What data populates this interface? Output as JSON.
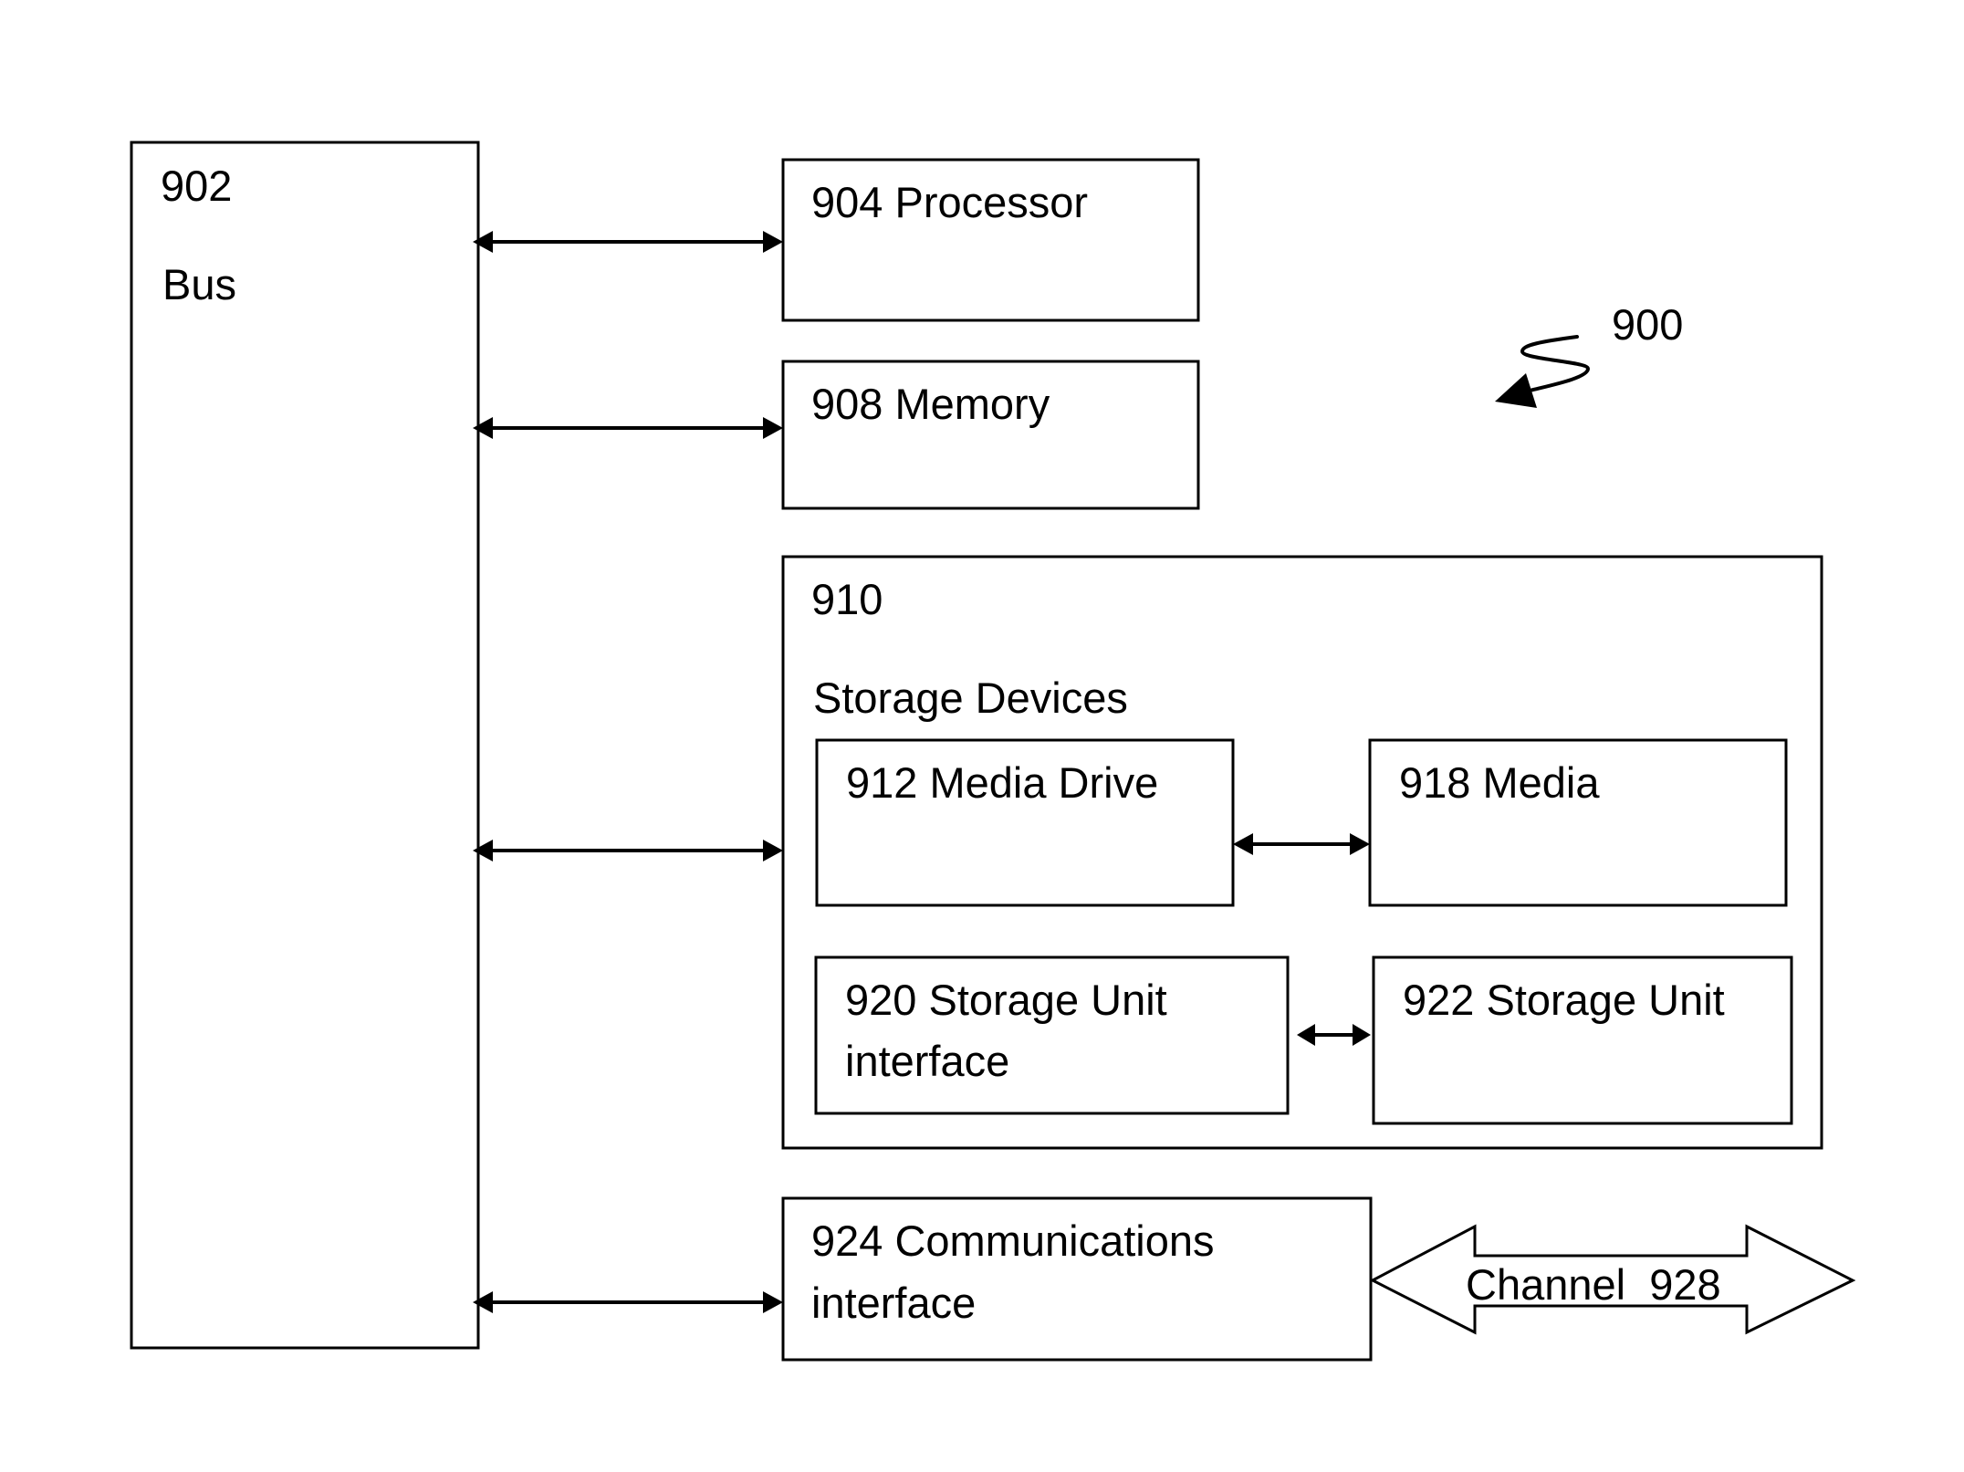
{
  "figure": {
    "reference": "900",
    "bus": {
      "number": "902",
      "label": "Bus"
    },
    "processor": {
      "label": "904 Processor"
    },
    "memory": {
      "label": "908 Memory"
    },
    "storage": {
      "number": "910",
      "label": "Storage Devices",
      "media_drive": {
        "label": "912 Media Drive"
      },
      "media": {
        "label": "918 Media"
      },
      "storage_unit_interface": {
        "line1": "920 Storage Unit",
        "line2": "interface"
      },
      "storage_unit": {
        "label": "922 Storage Unit"
      }
    },
    "communications": {
      "line1": "924 Communications",
      "line2": "interface"
    },
    "channel": {
      "label": "Channel  928"
    }
  },
  "colors": {
    "stroke": "#000000",
    "background": "#ffffff"
  }
}
